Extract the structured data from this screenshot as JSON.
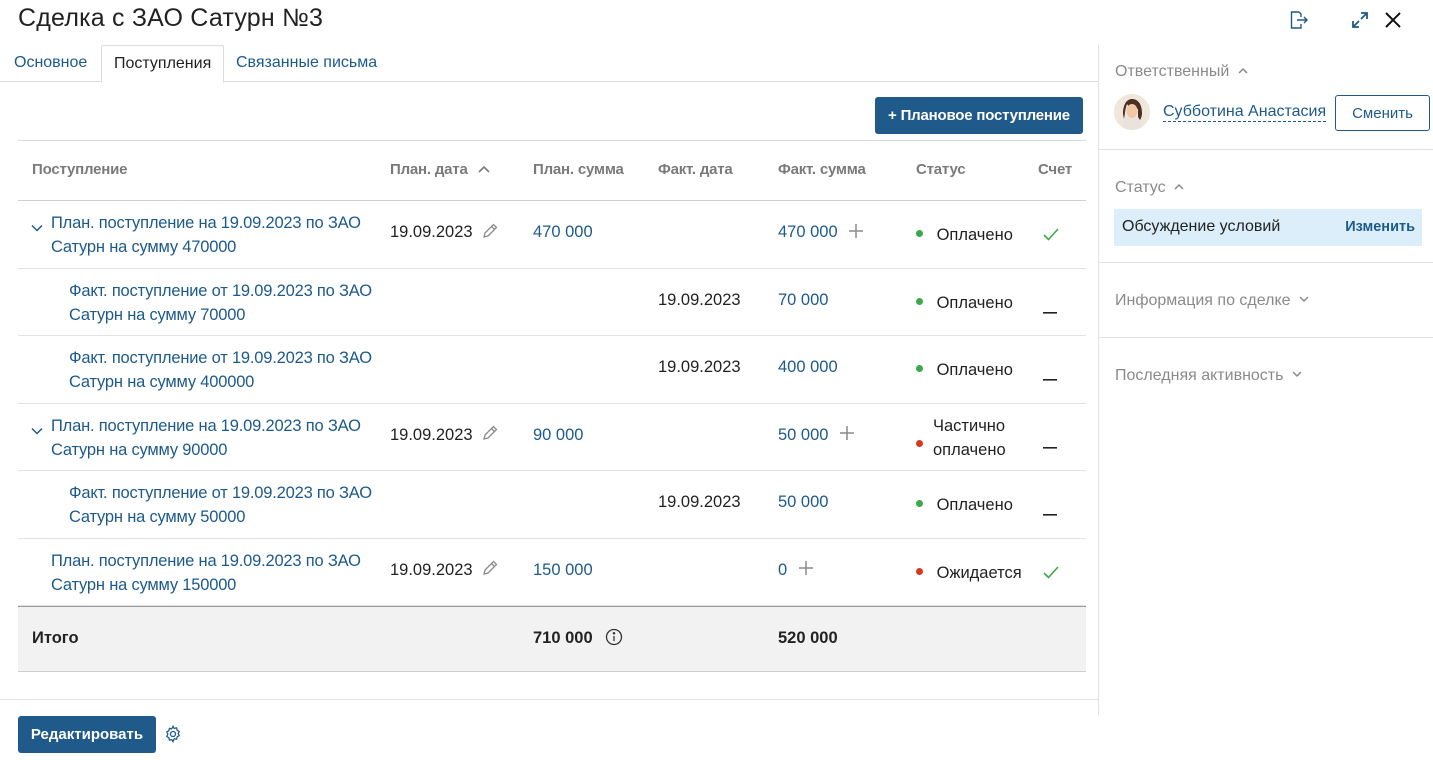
{
  "title": "Сделка с ЗАО Сатурн №3",
  "tabs": [
    {
      "label": "Основное"
    },
    {
      "label": "Поступления"
    },
    {
      "label": "Связанные письма"
    }
  ],
  "toolbar": {
    "add_planned_label": "+ Плановое поступление"
  },
  "table": {
    "columns": [
      "Поступление",
      "План. дата",
      "План. сумма",
      "Факт. дата",
      "Факт. сумма",
      "Статус",
      "Счет"
    ],
    "rows": [
      {
        "name_line1": "План. поступление на 19.09.2023 по ЗАО",
        "name_line2": "Сатурн на сумму 470000",
        "plan_date": "19.09.2023",
        "plan_sum": "470 000",
        "fact_date": "",
        "fact_sum": "470 000",
        "status_line1": "Оплачено",
        "status_line2": "",
        "status_color": "#3aa94a",
        "invoice": "check"
      },
      {
        "name_line1": "Факт. поступление от 19.09.2023 по ЗАО",
        "name_line2": "Сатурн на сумму 70000",
        "plan_date": "",
        "plan_sum": "",
        "fact_date": "19.09.2023",
        "fact_sum": "70 000",
        "status_line1": "Оплачено",
        "status_line2": "",
        "status_color": "#3aa94a",
        "invoice": "dash"
      },
      {
        "name_line1": "Факт. поступление от 19.09.2023 по ЗАО",
        "name_line2": "Сатурн на сумму 400000",
        "plan_date": "",
        "plan_sum": "",
        "fact_date": "19.09.2023",
        "fact_sum": "400 000",
        "status_line1": "Оплачено",
        "status_line2": "",
        "status_color": "#3aa94a",
        "invoice": "dash"
      },
      {
        "name_line1": "План. поступление на 19.09.2023 по ЗАО",
        "name_line2": "Сатурн на сумму 90000",
        "plan_date": "19.09.2023",
        "plan_sum": "90 000",
        "fact_date": "",
        "fact_sum": "50 000",
        "status_line1": "Частично",
        "status_line2": "оплачено",
        "status_color": "#d9381e",
        "invoice": "dash"
      },
      {
        "name_line1": "Факт. поступление от 19.09.2023 по ЗАО",
        "name_line2": "Сатурн на сумму 50000",
        "plan_date": "",
        "plan_sum": "",
        "fact_date": "19.09.2023",
        "fact_sum": "50 000",
        "status_line1": "Оплачено",
        "status_line2": "",
        "status_color": "#3aa94a",
        "invoice": "dash"
      },
      {
        "name_line1": "План. поступление на 19.09.2023 по ЗАО",
        "name_line2": "Сатурн на сумму 150000",
        "plan_date": "19.09.2023",
        "plan_sum": "150 000",
        "fact_date": "",
        "fact_sum": "0",
        "status_line1": "Ожидается",
        "status_line2": "",
        "status_color": "#d9381e",
        "invoice": "check"
      }
    ],
    "total": {
      "label": "Итого",
      "plan_sum": "710 000",
      "fact_sum": "520 000"
    }
  },
  "footer": {
    "edit_label": "Редактировать"
  },
  "sidebar": {
    "responsible_label": "Ответственный",
    "user_name": "Субботина Анастасия",
    "change_label": "Сменить",
    "status_label": "Статус",
    "status_value": "Обсуждение условий",
    "status_action": "Изменить",
    "deal_info_label": "Информация по сделке",
    "last_activity_label": "Последняя активность"
  },
  "colors": {
    "accent": "#1f5a8b",
    "link": "#1d5a8c",
    "paid": "#3aa94a",
    "unpaid": "#d9381e",
    "status_bg": "#dbeefa"
  }
}
